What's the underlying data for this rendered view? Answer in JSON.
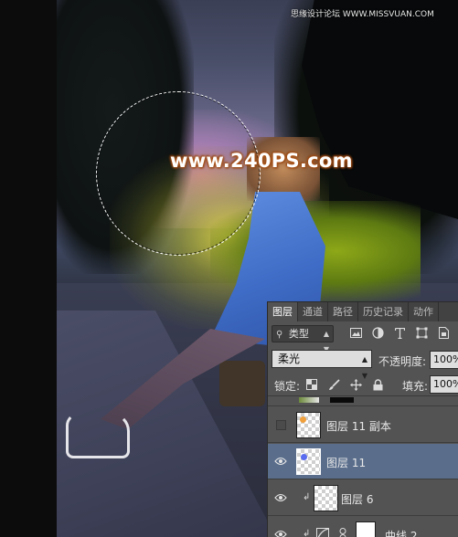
{
  "canvas": {
    "watermark_main": "www.240PS.com",
    "watermark_top": "思缘设计论坛 WWW.MISSVUAN.COM"
  },
  "panel": {
    "tabs": [
      {
        "label": "图层",
        "active": true
      },
      {
        "label": "通道",
        "active": false
      },
      {
        "label": "路径",
        "active": false
      },
      {
        "label": "历史记录",
        "active": false
      },
      {
        "label": "动作",
        "active": false
      }
    ],
    "filter": {
      "kind_label": "类型",
      "icons": [
        "image-filter-icon",
        "adjustment-filter-icon",
        "type-filter-icon",
        "shape-filter-icon",
        "smart-object-filter-icon"
      ]
    },
    "blend_mode": "柔光",
    "opacity_label": "不透明度:",
    "opacity_value": "100%",
    "lock_label": "锁定:",
    "lock_icons": [
      "lock-transparent-icon",
      "lock-paint-icon",
      "lock-move-icon",
      "lock-all-icon"
    ],
    "fill_label": "填充:",
    "fill_value": "100%",
    "layers": [
      {
        "name": "图层 11 副本",
        "visible": false,
        "selected": false,
        "dot_color": "#f0a03c"
      },
      {
        "name": "图层 11",
        "visible": true,
        "selected": true,
        "dot_color": "#5a6cf0"
      },
      {
        "name": "图层 6",
        "visible": true,
        "selected": false,
        "clipped": true
      },
      {
        "name": "曲线 2",
        "visible": true,
        "selected": false,
        "clipped": true,
        "adjustment": true
      }
    ]
  },
  "colors": {
    "panel_bg": "#535353",
    "selected_row": "#5a6e8c",
    "tab_bar": "#424242"
  }
}
